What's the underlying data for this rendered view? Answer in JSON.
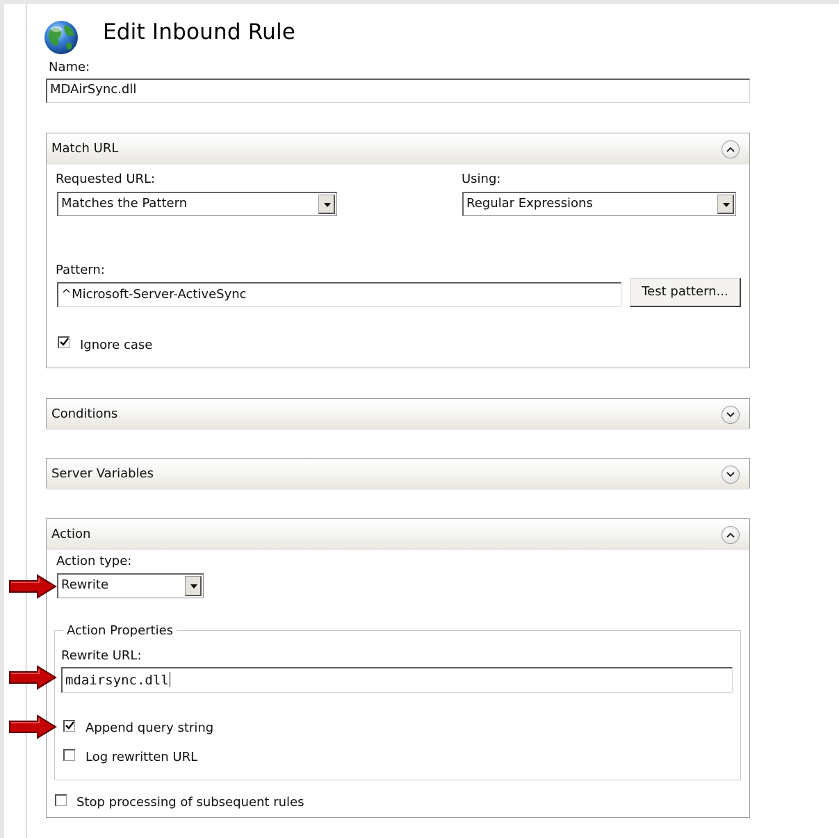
{
  "dialog": {
    "title": "Edit Inbound Rule"
  },
  "name_field": {
    "label": "Name:",
    "value": "MDAirSync.dll"
  },
  "match_url": {
    "title": "Match URL",
    "requested_url_label": "Requested URL:",
    "requested_url_value": "Matches the Pattern",
    "using_label": "Using:",
    "using_value": "Regular Expressions",
    "pattern_label": "Pattern:",
    "pattern_value": "^Microsoft-Server-ActiveSync",
    "test_button": "Test pattern...",
    "ignore_case_label": "Ignore case",
    "ignore_case_checked": true
  },
  "conditions": {
    "title": "Conditions"
  },
  "server_variables": {
    "title": "Server Variables"
  },
  "action": {
    "title": "Action",
    "action_type_label": "Action type:",
    "action_type_value": "Rewrite",
    "properties_legend": "Action Properties",
    "rewrite_url_label": "Rewrite URL:",
    "rewrite_url_value": "mdairsync.dll",
    "append_query_label": "Append query string",
    "append_query_checked": true,
    "log_rewritten_label": "Log rewritten URL",
    "log_rewritten_checked": false,
    "stop_processing_label": "Stop processing of subsequent rules",
    "stop_processing_checked": false
  },
  "icons": {
    "globe": "globe-icon",
    "collapse": "chevron-up-icon",
    "expand": "chevron-down-icon",
    "callout": "red-arrow-icon"
  },
  "colors": {
    "callout_arrow": "#c40000",
    "globe_blue": "#1e5fb4",
    "globe_green": "#3a9a2a"
  }
}
